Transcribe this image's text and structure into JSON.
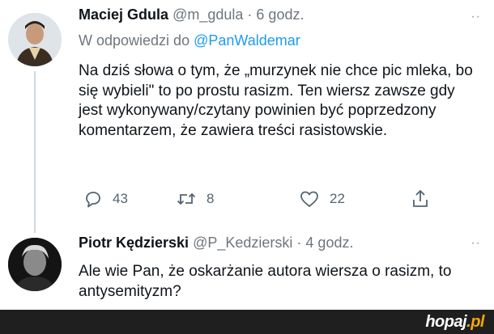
{
  "tweet1": {
    "name": "Maciej Gdula",
    "handle": "@m_gdula",
    "separator": "·",
    "time": "6 godz.",
    "reply_prefix": "W odpowiedzi do",
    "reply_mention": "@PanWaldemar",
    "text": "Na dziś słowa o tym, że „murzynek nie chce pic mleka, bo się wybieli\" to po prostu rasizm. Ten wiersz zawsze gdy jest wykonywany/czytany powinien być poprzedzony komentarzem, że zawiera treści rasistowskie.",
    "replies": "43",
    "retweets": "8",
    "likes": "22",
    "more": "··"
  },
  "tweet2": {
    "name": "Piotr Kędzierski",
    "handle": "@P_Kedzierski",
    "separator": "·",
    "time": "4 godz.",
    "text": "Ale wie Pan, że oskarżanie autora wiersza o rasizm, to antysemityzm?",
    "more": "··"
  },
  "watermark": {
    "brand": "hopaj",
    "tld": ".pl"
  },
  "colors": {
    "link": "#1d9bf0",
    "secondary_text": "#6e767d",
    "thread_line": "#cfd9de",
    "footer_bg": "#1f1f1f",
    "logo_accent": "#f2a900"
  }
}
